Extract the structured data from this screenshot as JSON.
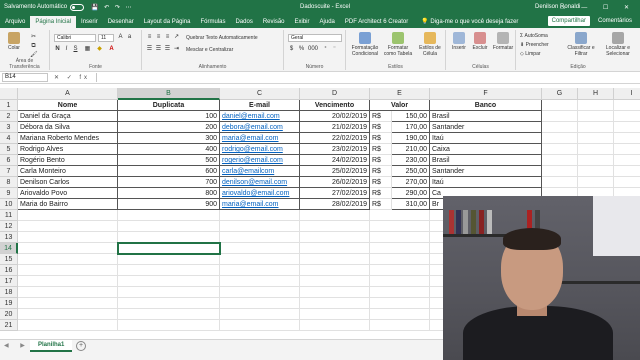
{
  "titlebar": {
    "autosave": "Salvamento Automático",
    "autosave_state": "Desativado",
    "quick_access": "💾 ↶ ↷ ⋯",
    "doc_title": "Dadoscuite - Excel",
    "user": "Denilson Ronaldi",
    "window_controls": "▭ — ☐ ✕"
  },
  "tabs": {
    "items": [
      "Arquivo",
      "Página Inicial",
      "Inserir",
      "Desenhar",
      "Layout da Página",
      "Fórmulas",
      "Dados",
      "Revisão",
      "Exibir",
      "Ajuda",
      "PDF Architect 6 Creator"
    ],
    "active_index": 1,
    "tell_me": "💡 Diga-me o que você deseja fazer",
    "share": "Compartilhar",
    "comments": "Comentários"
  },
  "ribbon": {
    "paste_label": "Colar",
    "clipboard_group": "Área de Transferência",
    "font_name": "Calibri",
    "font_size": "11",
    "font_group": "Fonte",
    "wrap_text": "Quebrar Texto Automaticamente",
    "merge_center": "Mesclar e Centralizar",
    "alignment_group": "Alinhamento",
    "number_format": "Geral",
    "number_group": "Número",
    "cond_format": "Formatação Condicional",
    "format_table": "Formatar como Tabela",
    "cell_styles": "Estilos de Célula",
    "styles_group": "Estilos",
    "insert": "Inserir",
    "delete": "Excluir",
    "format": "Formatar",
    "cells_group": "Células",
    "autosum": "AutoSoma",
    "fill": "Preencher",
    "clear": "Limpar",
    "sort_filter": "Classificar e Filtrar",
    "find_select": "Localizar e Selecionar",
    "editing_group": "Edição"
  },
  "formula_bar": {
    "name_box": "B14",
    "fx": "✕ ✓ fx",
    "content": ""
  },
  "sheet": {
    "columns": [
      "A",
      "B",
      "C",
      "D",
      "E",
      "F",
      "G",
      "H",
      "I"
    ],
    "selected_column": "B",
    "selected_row": 14,
    "headers": [
      "Nome",
      "Duplicata",
      "E-mail",
      "Vencimento",
      "Valor",
      "Banco"
    ],
    "rows": [
      [
        "Daniel da Graça",
        "100",
        "daniel@email.com",
        "20/02/2019",
        "R$",
        "150,00",
        "Brasil"
      ],
      [
        "Débora da Silva",
        "200",
        "debora@email.com",
        "21/02/2019",
        "R$",
        "170,00",
        "Santander"
      ],
      [
        "Mariana Roberto Mendes",
        "300",
        "maria@email.com",
        "22/02/2019",
        "R$",
        "190,00",
        "Itaú"
      ],
      [
        "Rodrigo Alves",
        "400",
        "rodrigo@email.com",
        "23/02/2019",
        "R$",
        "210,00",
        "Caixa"
      ],
      [
        "Rogério Bento",
        "500",
        "rogerio@email.com",
        "24/02/2019",
        "R$",
        "230,00",
        "Brasil"
      ],
      [
        "Carla Monteiro",
        "600",
        "carla@emailcom",
        "25/02/2019",
        "R$",
        "250,00",
        "Santander"
      ],
      [
        "Denilson Carlos",
        "700",
        "denilson@email.com",
        "26/02/2019",
        "R$",
        "270,00",
        "Itaú"
      ],
      [
        "Ariovaldo Povo",
        "800",
        "ariovaldo@email.com",
        "27/02/2019",
        "R$",
        "290,00",
        "Ca"
      ],
      [
        "Maria do Bairro",
        "900",
        "maria@email.com",
        "28/02/2019",
        "R$",
        "310,00",
        "Br"
      ]
    ],
    "row_numbers": [
      "1",
      "2",
      "3",
      "4",
      "5",
      "6",
      "7",
      "8",
      "9",
      "10",
      "11",
      "12",
      "13",
      "14",
      "15",
      "16",
      "17",
      "18",
      "19",
      "20",
      "21"
    ]
  },
  "sheet_tabs": {
    "nav": "◀ ▶",
    "active": "Planilha1",
    "add": "+"
  },
  "colors": {
    "brand": "#217346",
    "link": "#0563c1"
  }
}
